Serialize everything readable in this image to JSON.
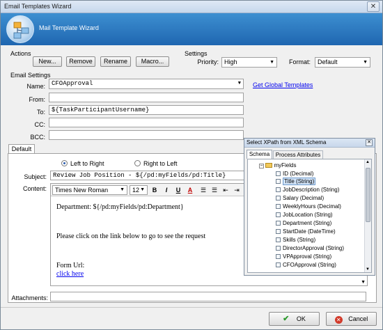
{
  "window": {
    "title": "Email Templates Wizard",
    "header_title": "Mail Template Wizard"
  },
  "actions": {
    "section_label": "Actions",
    "buttons": [
      "New...",
      "Remove",
      "Rename",
      "Macro..."
    ]
  },
  "settings": {
    "section_label": "Settings",
    "priority_label": "Priority:",
    "priority_value": "High",
    "format_label": "Format:",
    "format_value": "Default"
  },
  "email_settings": {
    "section_label": "Email Settings",
    "name_label": "Name:",
    "name_value": "CFOApproval",
    "get_global_link": "Get Global Templates",
    "from_label": "From:",
    "from_value": "",
    "to_label": "To:",
    "to_value": "${TaskParticipantUsername}",
    "cc_label": "CC:",
    "cc_value": "",
    "bcc_label": "BCC:",
    "bcc_value": ""
  },
  "editor": {
    "tab_default": "Default",
    "left_to_right": "Left to Right",
    "right_to_left": "Right to Left",
    "subject_label": "Subject:",
    "subject_value": "Review Job Position - ${/pd:myFields/pd:Title}",
    "content_label": "Content:",
    "font_name": "Times New Roman",
    "font_size": "12",
    "content_line1": "Department: ${/pd:myFields/pd:Department}",
    "content_line2": "Please click on the link below to go to see the request",
    "content_line3": "Form Url:",
    "content_link": "click here",
    "attachments_label": "Attachments:",
    "attachments_value": ""
  },
  "xpath_popup": {
    "title": "Select XPath from XML Schema",
    "tab_schema": "Schema",
    "tab_process": "Process Attributes",
    "root": "myFields",
    "fields": [
      "ID (Decimal)",
      "Title (String)",
      "JobDescription (String)",
      "Salary (Decimal)",
      "WeeklyHours (Decimal)",
      "JobLocation (String)",
      "Department (String)",
      "StartDate (DateTime)",
      "Skills (String)",
      "DirectorApproval (String)",
      "VPApproval (String)",
      "CFOApproval (String)"
    ],
    "selected_index": 1
  },
  "footer": {
    "ok_label": "OK",
    "cancel_label": "Cancel"
  }
}
